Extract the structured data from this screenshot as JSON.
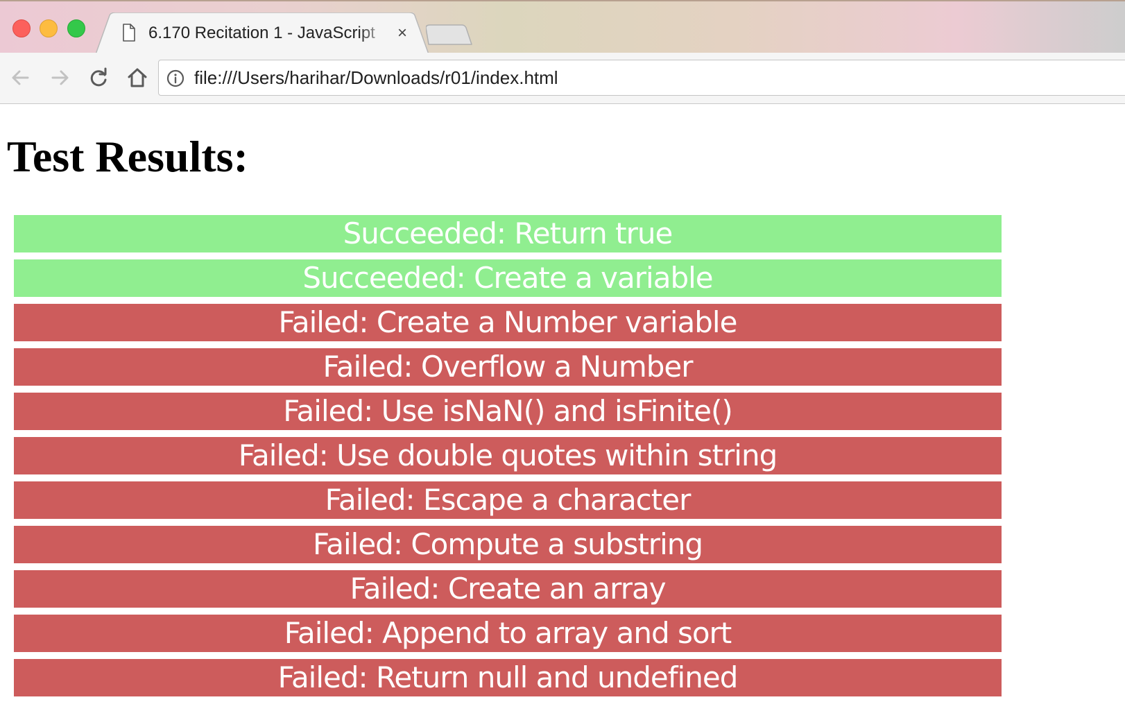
{
  "browser": {
    "tab": {
      "title": "6.170 Recitation 1 - JavaScript",
      "close_glyph": "×",
      "icon": "page-icon"
    },
    "new_tab_icon": "new-tab-icon",
    "nav": {
      "back_icon": "arrow-left-icon",
      "forward_icon": "arrow-right-icon",
      "reload_icon": "reload-icon",
      "home_icon": "home-icon"
    },
    "address_bar": {
      "info_icon": "info-icon",
      "url": "file:///Users/harihar/Downloads/r01/index.html"
    },
    "colors": {
      "close_red": "#fc605c",
      "minimize_yellow": "#fdbc40",
      "zoom_green": "#34c84a"
    }
  },
  "page": {
    "title": "Test Results:",
    "colors": {
      "succeeded": "#90ee90",
      "failed": "#cd5c5c"
    },
    "results": [
      {
        "status": "succeeded",
        "text": "Succeeded: Return true"
      },
      {
        "status": "succeeded",
        "text": "Succeeded: Create a variable"
      },
      {
        "status": "failed",
        "text": "Failed: Create a Number variable"
      },
      {
        "status": "failed",
        "text": "Failed: Overflow a Number"
      },
      {
        "status": "failed",
        "text": "Failed: Use isNaN() and isFinite()"
      },
      {
        "status": "failed",
        "text": "Failed: Use double quotes within string"
      },
      {
        "status": "failed",
        "text": "Failed: Escape a character"
      },
      {
        "status": "failed",
        "text": "Failed: Compute a substring"
      },
      {
        "status": "failed",
        "text": "Failed: Create an array"
      },
      {
        "status": "failed",
        "text": "Failed: Append to array and sort"
      },
      {
        "status": "failed",
        "text": "Failed: Return null and undefined"
      }
    ]
  }
}
